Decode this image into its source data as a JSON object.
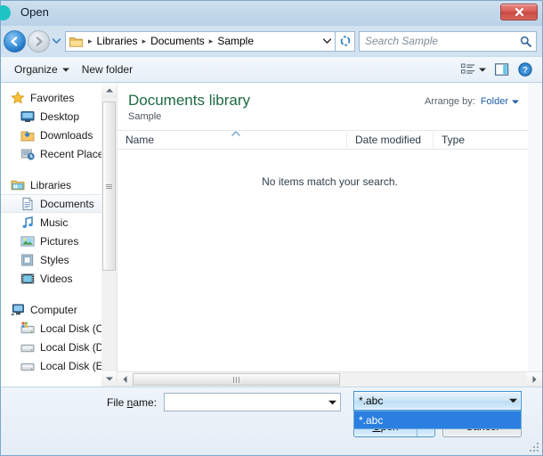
{
  "window": {
    "title": "Open",
    "app_icon": "teal-circle-icon",
    "close_label": "Close"
  },
  "nav": {
    "back_title": "Back",
    "forward_title": "Forward",
    "history_title": "Recent pages",
    "refresh_title": "Refresh",
    "breadcrumbs": [
      "Libraries",
      "Documents",
      "Sample"
    ],
    "separator": "▸"
  },
  "search": {
    "placeholder": "Search Sample",
    "icon": "magnifier-icon"
  },
  "toolbar": {
    "organize_label": "Organize",
    "new_folder_label": "New folder",
    "views_title": "Change your view",
    "preview_title": "Show the preview pane",
    "help_title": "Get help"
  },
  "sidebar": {
    "groups": [
      {
        "head": "Favorites",
        "head_icon": "star-icon",
        "items": [
          {
            "label": "Desktop",
            "icon": "desktop-icon",
            "selected": false
          },
          {
            "label": "Downloads",
            "icon": "downloads-icon",
            "selected": false
          },
          {
            "label": "Recent Places",
            "icon": "recent-places-icon",
            "selected": false
          }
        ]
      },
      {
        "head": "Libraries",
        "head_icon": "libraries-icon",
        "items": [
          {
            "label": "Documents",
            "icon": "documents-icon",
            "selected": true
          },
          {
            "label": "Music",
            "icon": "music-icon",
            "selected": false
          },
          {
            "label": "Pictures",
            "icon": "pictures-icon",
            "selected": false
          },
          {
            "label": "Styles",
            "icon": "styles-icon",
            "selected": false
          },
          {
            "label": "Videos",
            "icon": "videos-icon",
            "selected": false
          }
        ]
      },
      {
        "head": "Computer",
        "head_icon": "computer-icon",
        "items": [
          {
            "label": "Local Disk (C:)",
            "icon": "system-drive-icon",
            "selected": false
          },
          {
            "label": "Local Disk (D:)",
            "icon": "drive-icon",
            "selected": false
          },
          {
            "label": "Local Disk (E:)",
            "icon": "drive-icon",
            "selected": false
          }
        ]
      }
    ]
  },
  "main": {
    "library_title": "Documents library",
    "library_subtitle": "Sample",
    "arrange_label": "Arrange by:",
    "arrange_value": "Folder",
    "columns": [
      "Name",
      "Date modified",
      "Type"
    ],
    "empty_message": "No items match your search.",
    "sort_indicator": "ascending"
  },
  "footer": {
    "file_name_label_before": "File ",
    "file_name_accel": "n",
    "file_name_label_after": "ame:",
    "file_name_value": "",
    "filter_value": "*.abc",
    "filter_options": [
      "*.abc"
    ],
    "filter_selected_index": 0,
    "filter_open": true,
    "open_label_accel": "O",
    "open_label_rest": "pen",
    "cancel_label": "Cancel",
    "resize_grip": "resize-grip"
  },
  "colors": {
    "library_title": "#1d6b3f",
    "accent_link": "#1e5fa8",
    "selection": "#2a7fe0",
    "close_red": "#c94a42",
    "title_icon": "#1fc3c3"
  }
}
